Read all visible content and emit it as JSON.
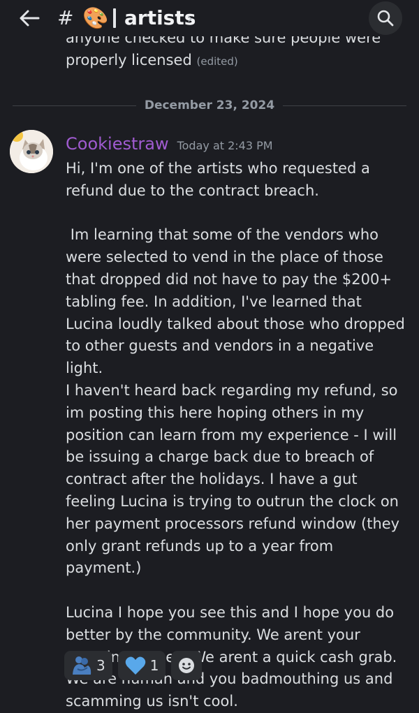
{
  "header": {
    "hash": "#",
    "channel_emoji": "🎨",
    "channel_name": "artists",
    "chevron": "›",
    "icons": [
      "back-arrow-icon",
      "palette-icon",
      "search-icon"
    ]
  },
  "previous_message": {
    "line1": "anyone checked to make sure people were",
    "line2": "properly licensed",
    "edited": "(edited)"
  },
  "date_divider": "December 23, 2024",
  "message": {
    "author": "Cookiestraw",
    "author_color": "#a05bd0",
    "timestamp": "Today at 2:43 PM",
    "body": "Hi, I'm one of the artists who requested a refund due to the contract breach.\n\n Im learning that some of the vendors who were selected to vend in the place of those that dropped did not have to pay the $200+ tabling fee. In addition, I've learned that Lucina loudly talked about those who dropped to other guests and vendors in a negative light.\nI haven't heard back regarding my refund, so im posting this here hoping others in my position can learn from my experience - I will be issuing a charge back due to breach of contract after the holidays. I have a gut feeling Lucina is trying to outrun the clock on her payment processors refund window (they only grant refunds up to a year from payment.)\n\nLucina I hope you see this and I hope you do better by the community. We arent your stepping stones. We arent a quick cash grab. We are human and you badmouthing us and scamming us isn't cool."
  },
  "reactions": [
    {
      "icon": "people-hugging-icon",
      "count": "3"
    },
    {
      "icon": "blue-heart-icon",
      "count": "1"
    },
    {
      "icon": "add-reaction-icon"
    }
  ]
}
